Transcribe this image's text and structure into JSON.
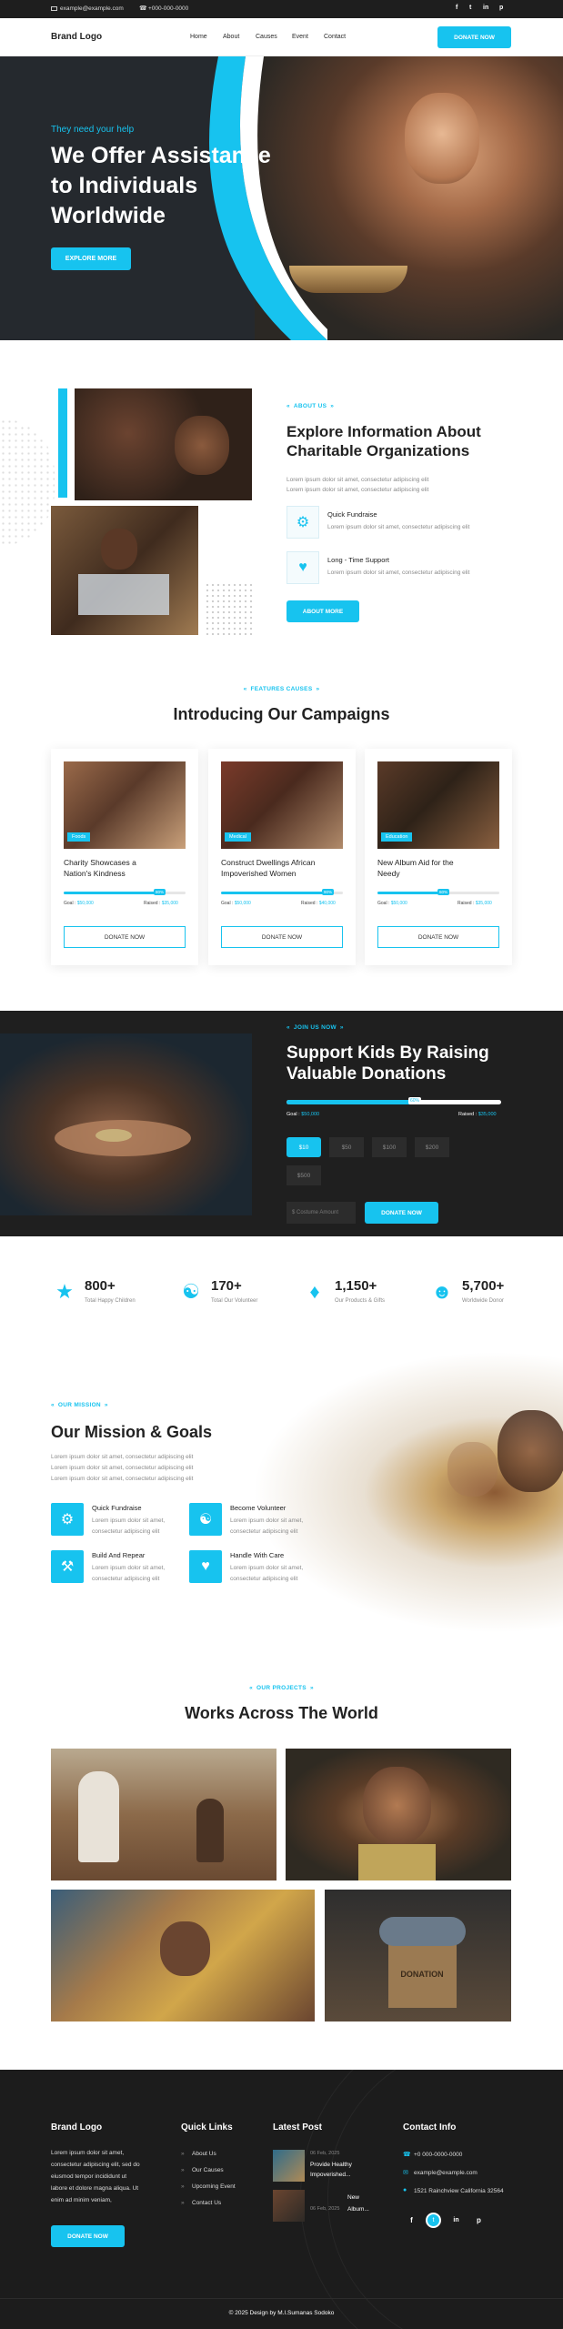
{
  "topbar": {
    "email": "example@example.com",
    "phone": "+000-000-0000",
    "social": [
      "facebook-icon",
      "twitter-icon",
      "linkedin-icon",
      "pinterest-icon"
    ]
  },
  "nav": {
    "logo": "Brand Logo",
    "links": [
      "Home",
      "About",
      "Causes",
      "Event",
      "Contact"
    ],
    "cta": "DONATE NOW"
  },
  "hero": {
    "tagline": "They need your help",
    "title_l1": "We Offer Assistance",
    "title_l2": "to Individuals",
    "title_l3": "Worldwide",
    "button": "EXPLORE MORE"
  },
  "about": {
    "tag": "ABOUT US",
    "title_l1": "Explore Information About",
    "title_l2": "Charitable Organizations",
    "desc_l1": "Lorem ipsum dolor sit amet, consectetur adipiscing elit",
    "desc_l2": "Lorem ipsum dolor sit amet, consectetur adipiscing elit",
    "features": [
      {
        "title": "Quick Fundraise",
        "desc": "Lorem ipsum dolor sit amet, consectetur adipiscing elit"
      },
      {
        "title": "Long - Time Support",
        "desc": "Lorem ipsum dolor sit amet, consectetur adipiscing elit"
      }
    ],
    "button": "ABOUT MORE"
  },
  "campaigns": {
    "tag": "FEATURES CAUSES",
    "title": "Introducing Our Campaigns",
    "cards": [
      {
        "badge": "Foods",
        "title_l1": "Charity Showcases a",
        "title_l2": "Nation's Kindness",
        "progress": 0.8,
        "pct": "80%",
        "goal_label": "Goal :",
        "goal": "$50,000",
        "raised_label": "Raised :",
        "raised": "$35,000",
        "button": "DONATE NOW"
      },
      {
        "badge": "Medical",
        "title_l1": "Construct Dwellings African",
        "title_l2": "Impoverished Women",
        "progress": 0.89,
        "pct": "90%",
        "goal_label": "Goal :",
        "goal": "$50,000",
        "raised_label": "Raised :",
        "raised": "$40,000",
        "button": "DONATE NOW"
      },
      {
        "badge": "Education",
        "title_l1": "New Album Aid for the",
        "title_l2": "Needy",
        "progress": 0.55,
        "pct": "60%",
        "goal_label": "Goal :",
        "goal": "$50,000",
        "raised_label": "Raised :",
        "raised": "$35,000",
        "button": "DONATE NOW"
      }
    ]
  },
  "join": {
    "tag": "JOIN US NOW",
    "title_l1": "Support Kids By Raising",
    "title_l2": "Valuable Donations",
    "progress": 0.6,
    "pct": "60%",
    "goal_label": "Goal :",
    "goal": "$50,000",
    "raised_label": "Raised :",
    "raised": "$35,000",
    "amounts": [
      "$10",
      "$50",
      "$100",
      "$200",
      "$500"
    ],
    "custom_placeholder": "$ Costume Amount",
    "button": "DONATE NOW"
  },
  "stats": [
    {
      "icon": "people-icon",
      "value": "800+",
      "label": "Total Happy Children"
    },
    {
      "icon": "handshake-icon",
      "value": "170+",
      "label": "Total Our Volunteer"
    },
    {
      "icon": "gift-icon",
      "value": "1,150+",
      "label": "Our Products & Gifts"
    },
    {
      "icon": "donor-icon",
      "value": "5,700+",
      "label": "Worldwide Donor"
    }
  ],
  "mission": {
    "tag": "OUR MISSION",
    "title": "Our Mission & Goals",
    "desc": [
      "Lorem ipsum dolor sit amet, consectetur adipiscing elit",
      "Lorem ipsum dolor sit amet, consectetur adipiscing elit",
      "Lorem ipsum dolor sit amet, consectetur adipiscing elit"
    ],
    "items": [
      {
        "title": "Quick Fundraise",
        "d1": "Lorem ipsum dolor sit amet,",
        "d2": "consectetur adipiscing elit"
      },
      {
        "title": "Become Volunteer",
        "d1": "Lorem ipsum dolor sit amet,",
        "d2": "consectetur adipiscing elit"
      },
      {
        "title": "Build And Repear",
        "d1": "Lorem ipsum dolor sit amet,",
        "d2": "consectetur adipiscing elit"
      },
      {
        "title": "Handle With Care",
        "d1": "Lorem ipsum dolor sit amet,",
        "d2": "consectetur adipiscing elit"
      }
    ]
  },
  "projects": {
    "tag": "OUR PROJECTS",
    "title": "Works Across The World",
    "donation_text": "DONATION"
  },
  "footer": {
    "logo": "Brand Logo",
    "about_l1": "Lorem ipsum dolor sit amet,",
    "about_l2": "consectetur adipiscing elit, sed do",
    "about_l3": "eiusmod tempor incididunt ut",
    "about_l4": "labore et dolore magna aliqua. Ut",
    "about_l5": "enim ad minim veniam,",
    "button": "DONATE NOW",
    "links_title": "Quick Links",
    "links": [
      "About Us",
      "Our Causes",
      "Upcoming Event",
      "Contact Us"
    ],
    "posts_title": "Latest Post",
    "posts": [
      {
        "date": "06 Feb, 2025",
        "l1": "Provide Healthy",
        "l2": "Impoverished..."
      },
      {
        "date": "06 Feb, 2025",
        "l1": "New",
        "l2": "Album..."
      }
    ],
    "contact_title": "Contact Info",
    "phone": "+0 000-0000-0000",
    "email": "example@example.com",
    "address": "1521 Rainchview California 32564",
    "copyright": "© 2025 Design by M.I.Sumanas Sodoko"
  }
}
